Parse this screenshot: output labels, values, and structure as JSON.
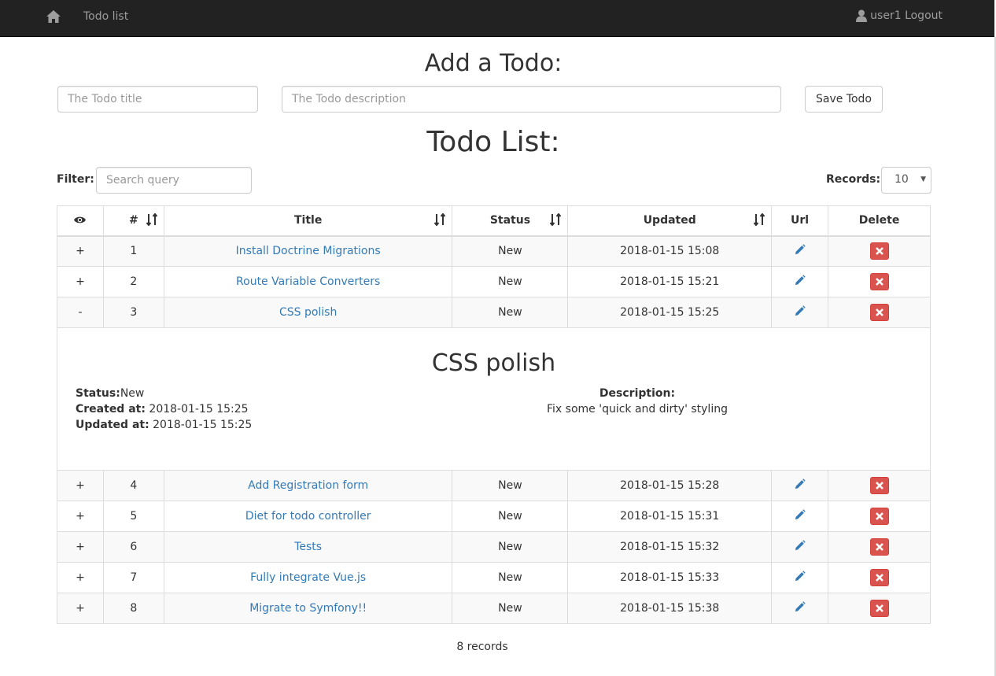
{
  "nav": {
    "brand": "Todo list",
    "user_label": "user1 Logout"
  },
  "add_form": {
    "heading": "Add a Todo:",
    "title_placeholder": "The Todo title",
    "description_placeholder": "The Todo description",
    "save_label": "Save Todo"
  },
  "list": {
    "heading": "Todo List:",
    "filter_label": "Filter:",
    "filter_placeholder": "Search query",
    "records_label": "Records:",
    "records_value": "10",
    "columns": {
      "num": "#",
      "title": "Title",
      "status": "Status",
      "updated": "Updated",
      "url": "Url",
      "delete": "Delete"
    },
    "rows": [
      {
        "toggle": "+",
        "num": "1",
        "title": "Install Doctrine Migrations",
        "status": "New",
        "updated": "2018-01-15 15:08"
      },
      {
        "toggle": "+",
        "num": "2",
        "title": "Route Variable Converters",
        "status": "New",
        "updated": "2018-01-15 15:21"
      },
      {
        "toggle": "-",
        "num": "3",
        "title": "CSS polish",
        "status": "New",
        "updated": "2018-01-15 15:25"
      },
      {
        "toggle": "+",
        "num": "4",
        "title": "Add Registration form",
        "status": "New",
        "updated": "2018-01-15 15:28"
      },
      {
        "toggle": "+",
        "num": "5",
        "title": "Diet for todo controller",
        "status": "New",
        "updated": "2018-01-15 15:31"
      },
      {
        "toggle": "+",
        "num": "6",
        "title": "Tests",
        "status": "New",
        "updated": "2018-01-15 15:32"
      },
      {
        "toggle": "+",
        "num": "7",
        "title": "Fully integrate Vue.js",
        "status": "New",
        "updated": "2018-01-15 15:33"
      },
      {
        "toggle": "+",
        "num": "8",
        "title": "Migrate to Symfony!!",
        "status": "New",
        "updated": "2018-01-15 15:38"
      }
    ],
    "detail": {
      "title": "CSS polish",
      "status_label": "Status:",
      "status_value": "New",
      "created_label": "Created at:",
      "created_value": "2018-01-15 15:25",
      "updated_label": "Updated at:",
      "updated_value": "2018-01-15 15:25",
      "description_label": "Description:",
      "description_value": "Fix some 'quick and dirty' styling"
    },
    "footer": "8 records"
  },
  "icons": {
    "home": "home-icon",
    "user": "user-icon",
    "eye": "eye-icon",
    "sort": "sort-icon",
    "pencil": "pencil-icon",
    "delete": "remove-icon"
  },
  "colors": {
    "navbar": "#222222",
    "nav_text": "#9d9d9d",
    "link": "#337ab7",
    "danger": "#d9534f",
    "stripe": "#f9f9f9",
    "border": "#dddddd"
  }
}
